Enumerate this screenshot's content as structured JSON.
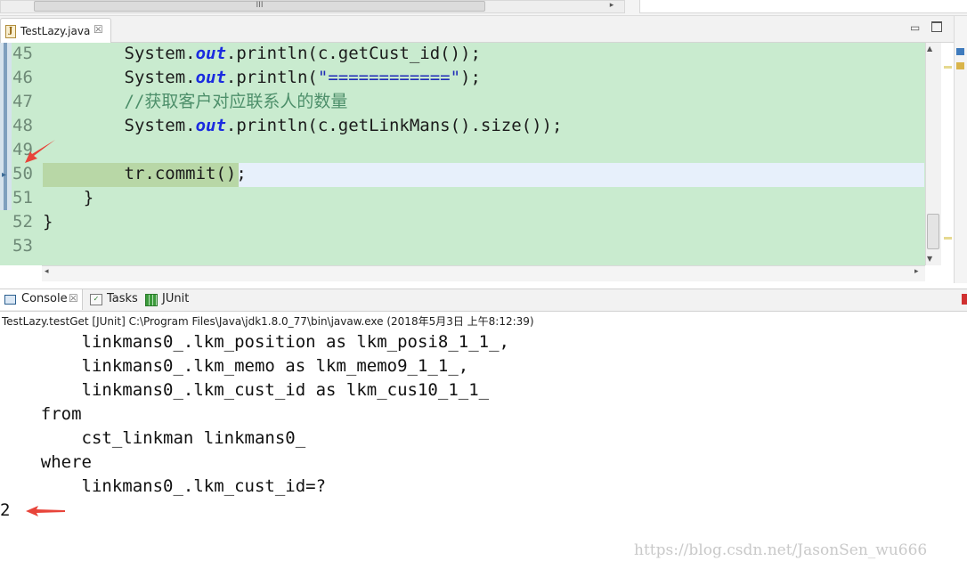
{
  "top_strip": {
    "thumb_grip": "III",
    "right_arrow": "▸"
  },
  "editor": {
    "tab": {
      "icon": "J",
      "label": "TestLazy.java",
      "close": "☒"
    },
    "window_controls": {
      "minimize": "▭"
    },
    "lines": [
      {
        "num": "45",
        "parts": [
          "        System.",
          "out",
          ".println(c.getCust_id());"
        ]
      },
      {
        "num": "46",
        "parts": [
          "        System.",
          "out",
          ".println(",
          "\"============\"",
          ");"
        ]
      },
      {
        "num": "47",
        "comment": "        //获取客户对应联系人的数量"
      },
      {
        "num": "48",
        "parts": [
          "        System.",
          "out",
          ".println(c.getLinkMans().size());"
        ]
      },
      {
        "num": "49",
        "text": ""
      },
      {
        "num": "50",
        "text": "        tr.commit();"
      },
      {
        "num": "51",
        "text": "    }"
      },
      {
        "num": "52",
        "text": "}"
      },
      {
        "num": "53",
        "text": ""
      }
    ],
    "scroll": {
      "up": "▲",
      "down": "▼",
      "left": "◂",
      "right": "▸"
    }
  },
  "console_view": {
    "tabs": [
      {
        "label": "Console",
        "icon": "console-icon"
      },
      {
        "label": "Tasks",
        "icon": "tasks-icon"
      },
      {
        "label": "JUnit",
        "icon": "junit-icon"
      }
    ],
    "close": "☒",
    "launch_description": "TestLazy.testGet [JUnit] C:\\Program Files\\Java\\jdk1.8.0_77\\bin\\javaw.exe (2018年5月3日 上午8:12:39)",
    "output_lines": [
      "        linkmans0_.lkm_position as lkm_posi8_1_1_,",
      "        linkmans0_.lkm_memo as lkm_memo9_1_1_,",
      "        linkmans0_.lkm_cust_id as lkm_cus10_1_1_",
      "    from",
      "        cst_linkman linkmans0_",
      "    where",
      "        linkmans0_.lkm_cust_id=?",
      "2"
    ]
  },
  "watermark": "https://blog.csdn.net/JasonSen_wu666",
  "colors": {
    "editor_bg": "#c9ebcf",
    "current_line": "#e7f0fb",
    "keyword_out": "#1a2be0",
    "comment": "#4d8f6a",
    "arrow": "#e8443a"
  }
}
